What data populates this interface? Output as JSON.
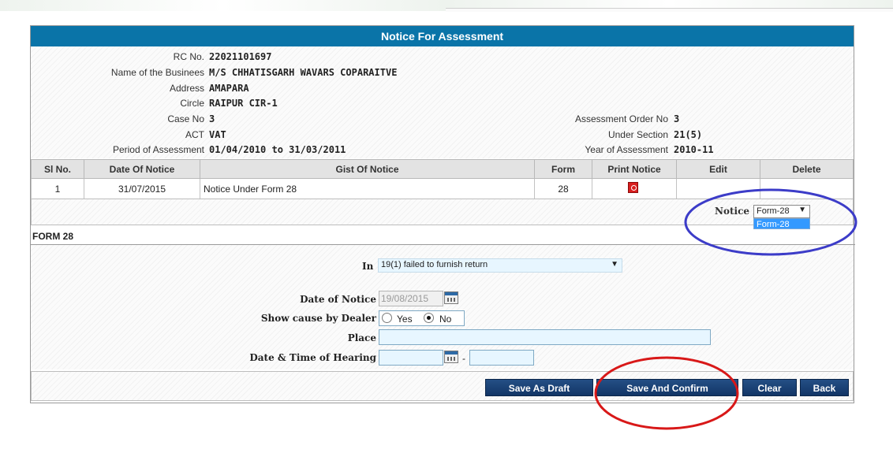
{
  "page": {
    "title": "Notice For Assessment"
  },
  "info": {
    "rc_label": "RC No.",
    "rc_value": "22021101697",
    "name_label": "Name of the Businees",
    "name_value": "M/S CHHATISGARH WAVARS COPARAITVE",
    "address_label": "Address",
    "address_value": "AMAPARA",
    "circle_label": "Circle",
    "circle_value": "RAIPUR CIR-1",
    "case_label": "Case No",
    "case_value": "3",
    "act_label": "ACT",
    "act_value": "VAT",
    "period_label": "Period of Assessment",
    "period_value": "01/04/2010 to 31/03/2011",
    "order_label": "Assessment Order No",
    "order_value": "3",
    "section_label": "Under Section",
    "section_value": "21(5)",
    "year_label": "Year of Assessment",
    "year_value": "2010-11"
  },
  "table": {
    "headers": [
      "Sl No.",
      "Date Of Notice",
      "Gist Of Notice",
      "Form",
      "Print Notice",
      "Edit",
      "Delete"
    ],
    "rows": [
      {
        "sl": "1",
        "date": "31/07/2015",
        "gist": "Notice Under Form 28",
        "form": "28"
      }
    ]
  },
  "notice_in": {
    "label": "Notice In",
    "selected": "Form-28",
    "options": [
      "Form-28"
    ]
  },
  "form": {
    "title": "FORM 28",
    "in_label": "In",
    "in_value": "19(1) failed to furnish return",
    "date_label": "Date of Notice",
    "date_value": "19/08/2015",
    "show_cause_label": "Show cause by Dealer",
    "yes_label": "Yes",
    "no_label": "No",
    "place_label": "Place",
    "hearing_label": "Date & Time of Hearing",
    "hearing_sep": "-"
  },
  "buttons": {
    "draft": "Save As Draft",
    "confirm": "Save And Confirm",
    "clear": "Clear",
    "back": "Back"
  },
  "annotations": {
    "blue_circle_color": "#3c3cc8",
    "red_circle_color": "#d81818"
  }
}
